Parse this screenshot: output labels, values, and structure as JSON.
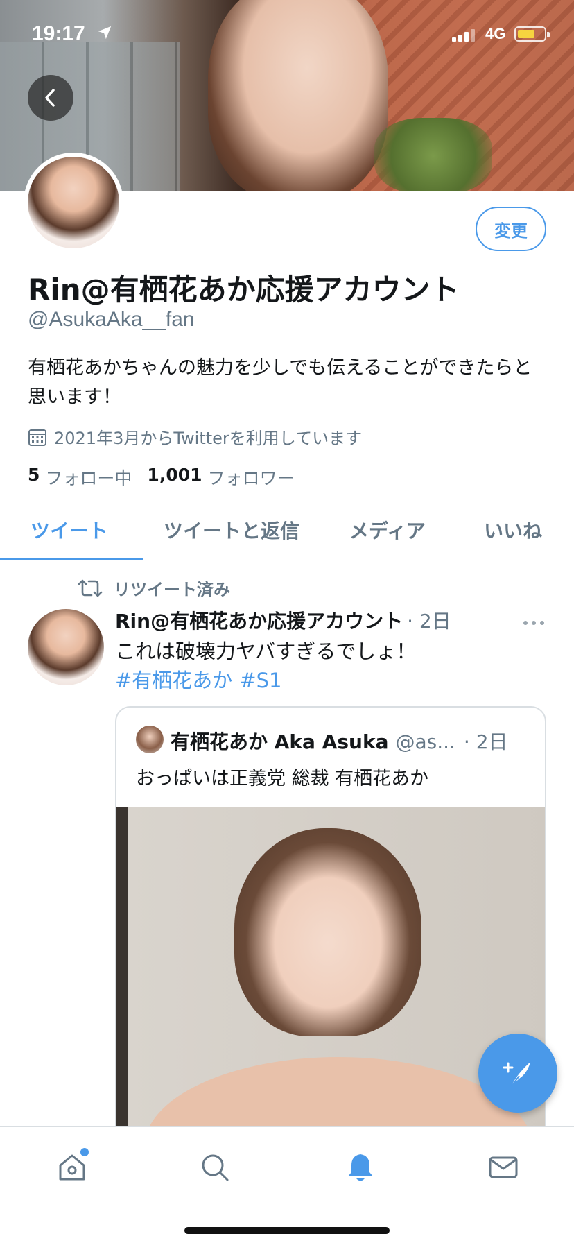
{
  "status_bar": {
    "time": "19:17",
    "network": "4G"
  },
  "profile": {
    "display_name": "Rin@有栖花あか応援アカウント",
    "handle": "@AsukaAka__fan",
    "edit_label": "変更",
    "bio": "有栖花あかちゃんの魅力を少しでも伝えることができたらと思います！",
    "joined": "2021年3月からTwitterを利用しています",
    "following_count": "5",
    "following_label": "フォロー中",
    "followers_count": "1,001",
    "followers_label": "フォロワー"
  },
  "tabs": [
    {
      "label": "ツイート"
    },
    {
      "label": "ツイートと返信"
    },
    {
      "label": "メディア"
    },
    {
      "label": "いいね"
    }
  ],
  "tweet": {
    "retweet_note": "リツイート済み",
    "author": "Rin@有栖花あか応援アカウント",
    "time": "· 2日",
    "text": "これは破壊力ヤバすぎるでしょ！",
    "hashtags": [
      "#有栖花あか",
      "#S1"
    ],
    "quote": {
      "author": "有栖花あか Aka Asuka",
      "handle": "@as...",
      "time": "· 2日",
      "text": "おっぱいは正義党 総裁 有栖花あか"
    }
  },
  "icons": {
    "back": "chevron-left-icon",
    "retweet": "retweet-icon",
    "calendar": "calendar-icon",
    "more": "more-horizontal-icon",
    "compose": "compose-feather-icon",
    "nav": [
      "home-icon",
      "search-icon",
      "notifications-bell-icon",
      "messages-envelope-icon"
    ]
  },
  "colors": {
    "accent": "#4a99e9",
    "secondary_text": "#657786",
    "battery": "#f6d33f"
  }
}
